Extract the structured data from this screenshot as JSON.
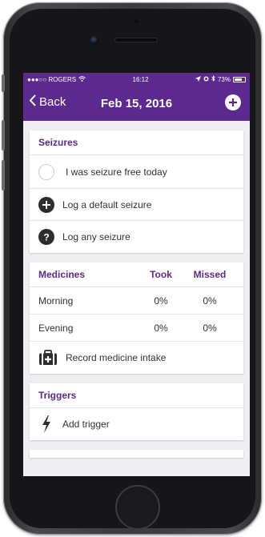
{
  "status_bar": {
    "carrier": "●●●○○ ROGERS",
    "time": "16:12",
    "battery": "73%"
  },
  "nav": {
    "back_label": "Back",
    "title": "Feb 15, 2016"
  },
  "seizures": {
    "header": "Seizures",
    "items": [
      {
        "label": "I was seizure free today",
        "icon": "empty-circle-icon"
      },
      {
        "label": "Log a default seizure",
        "icon": "plus-circle-icon"
      },
      {
        "label": "Log any seizure",
        "icon": "question-circle-icon"
      }
    ]
  },
  "medicines": {
    "header": "Medicines",
    "col_took": "Took",
    "col_missed": "Missed",
    "rows": [
      {
        "name": "Morning",
        "took": "0%",
        "missed": "0%"
      },
      {
        "name": "Evening",
        "took": "0%",
        "missed": "0%"
      }
    ],
    "action_label": "Record medicine intake"
  },
  "triggers": {
    "header": "Triggers",
    "action_label": "Add trigger"
  },
  "colors": {
    "accent": "#5c2a8e",
    "background": "#efeff2"
  }
}
